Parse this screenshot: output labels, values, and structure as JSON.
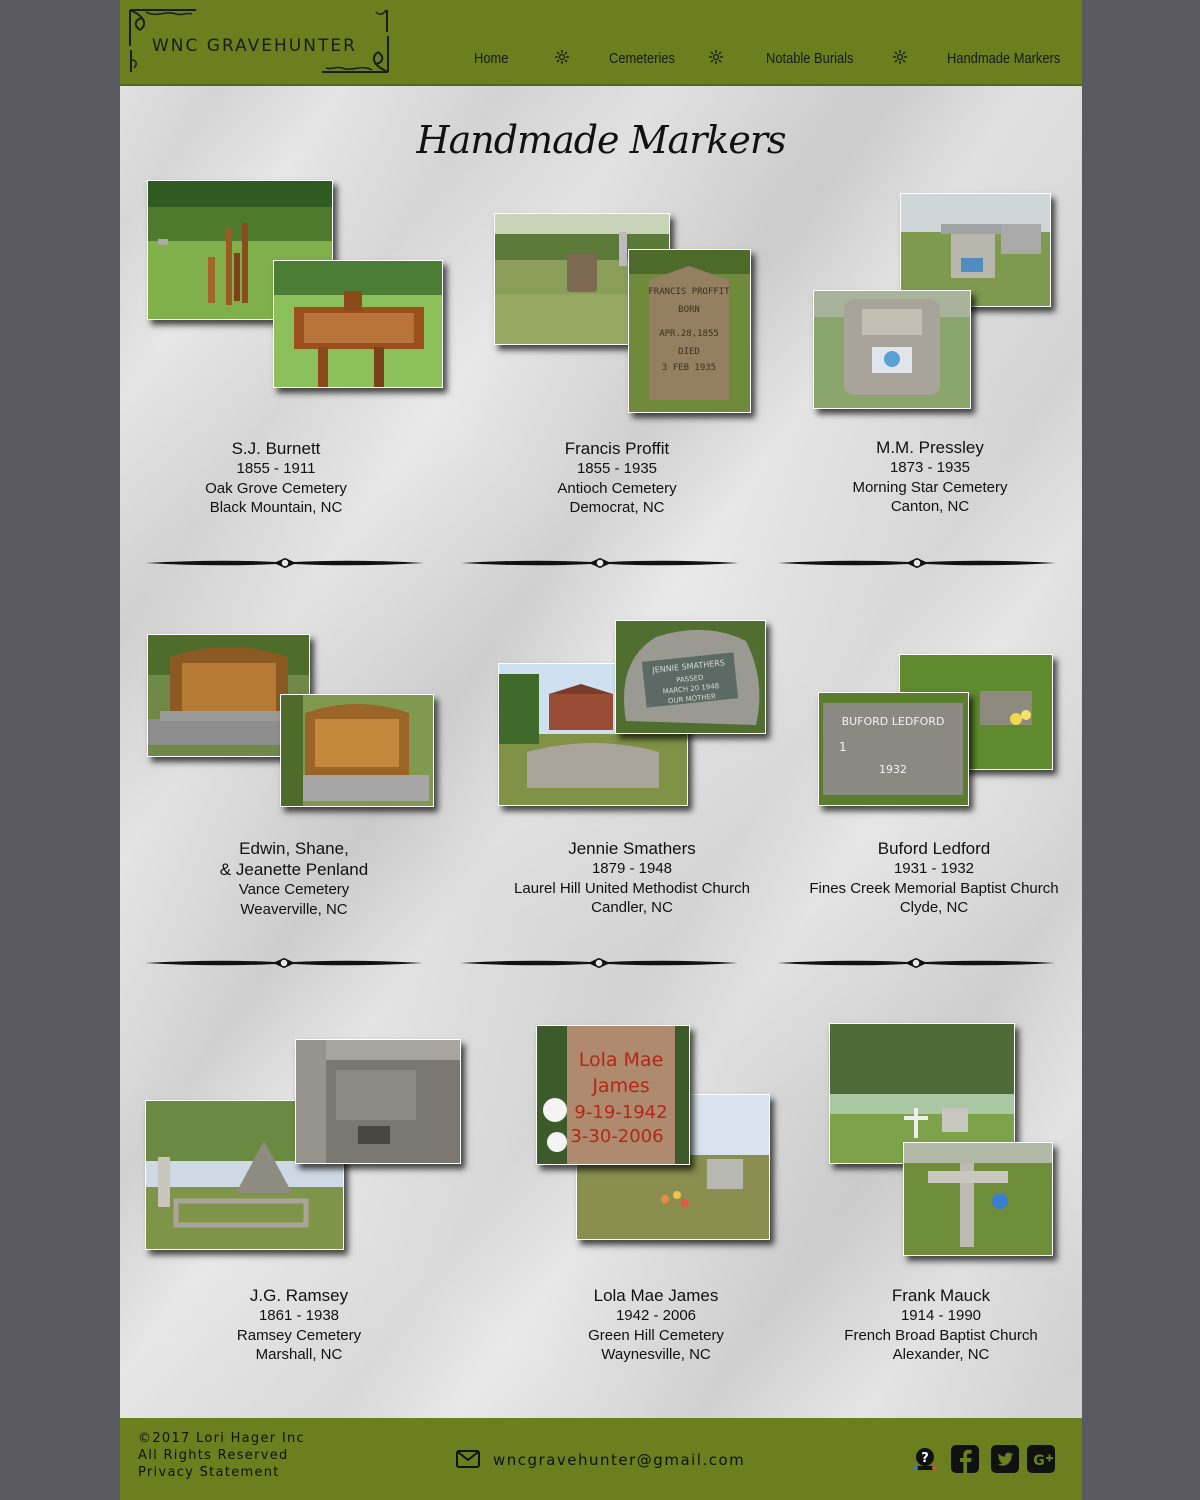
{
  "header": {
    "logo_text": "WNC GRAVEHUNTER",
    "nav": [
      "Home",
      "Cemeteries",
      "Notable Burials",
      "Handmade Markers"
    ]
  },
  "main": {
    "title": "Handmade Markers",
    "cards": [
      {
        "name": "S.J. Burnett",
        "years": "1855 - 1911",
        "cemetery": "Oak Grove Cemetery",
        "location": "Black Mountain, NC"
      },
      {
        "name": "Francis Proffit",
        "years": "1855 - 1935",
        "cemetery": "Antioch Cemetery",
        "location": "Democrat, NC"
      },
      {
        "name": "M.M. Pressley",
        "years": "1873 - 1935",
        "cemetery": "Morning Star Cemetery",
        "location": "Canton, NC"
      },
      {
        "name": "Edwin, Shane,",
        "name2": "& Jeanette Penland",
        "cemetery": "Vance Cemetery",
        "location": "Weaverville, NC"
      },
      {
        "name": "Jennie Smathers",
        "years": "1879 - 1948",
        "cemetery": "Laurel Hill United Methodist Church",
        "location": "Candler, NC"
      },
      {
        "name": "Buford Ledford",
        "years": "1931 - 1932",
        "cemetery": "Fines Creek Memorial Baptist Church",
        "location": "Clyde, NC"
      },
      {
        "name": "J.G. Ramsey",
        "years": "1861 - 1938",
        "cemetery": "Ramsey Cemetery",
        "location": "Marshall, NC"
      },
      {
        "name": "Lola Mae James",
        "years": "1942 - 2006",
        "cemetery": "Green Hill Cemetery",
        "location": "Waynesville, NC"
      },
      {
        "name": "Frank Mauck",
        "years": "1914 - 1990",
        "cemetery": "French Broad Baptist Church",
        "location": "Alexander, NC"
      }
    ],
    "photo_text": {
      "proffit": [
        "FRANCIS PROFFIT",
        "BORN",
        "APR.28,1855",
        "DIED",
        "3 FEB 1935"
      ],
      "smathers": [
        "JENNIE SMATHERS",
        "PASSED",
        "MARCH 20 1948",
        "OUR MOTHER"
      ],
      "ledford": [
        "BUFORD LEDFORD",
        "1",
        "1932"
      ],
      "lola": [
        "Lola Mae",
        "James",
        "9-19-1942",
        "3-30-2006"
      ]
    }
  },
  "footer": {
    "copyright": "2017 Lori Hager Inc",
    "rights": "All Rights Reserved",
    "privacy": "Privacy Statement",
    "email": "wncgravehunter@gmail.com",
    "colors": {
      "header": "#6b7f1e",
      "side": "#5a5a60"
    },
    "social_icons": [
      "findagrave-icon",
      "facebook-icon",
      "twitter-icon",
      "google-plus-icon"
    ]
  }
}
